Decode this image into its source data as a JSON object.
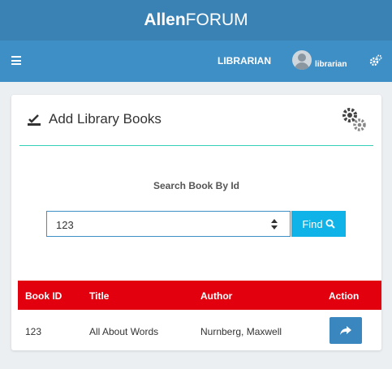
{
  "header": {
    "brand_bold": "Allen",
    "brand_rest": "FORUM"
  },
  "navbar": {
    "role": "LIBRARIAN",
    "username": "librarian"
  },
  "card": {
    "title": "Add Library Books",
    "search": {
      "label": "Search Book By Id",
      "value": "123",
      "button_label": "Find"
    },
    "table": {
      "columns": [
        "Book ID",
        "Title",
        "Author",
        "Action"
      ],
      "rows": [
        {
          "book_id": "123",
          "title": "All About Words",
          "author": "Nurnberg, Maxwell"
        }
      ]
    }
  },
  "colors": {
    "header": "#3b82b4",
    "navbar": "#3f8fc7",
    "table_header": "#e2000f",
    "find_button": "#10b3e8",
    "divider": "#35d0b8"
  },
  "icons": {
    "menu": "hamburger-icon",
    "user": "avatar-icon",
    "settings": "cogs-icon",
    "add": "pen-check-icon",
    "search": "search-icon",
    "action": "share-arrow-icon"
  }
}
